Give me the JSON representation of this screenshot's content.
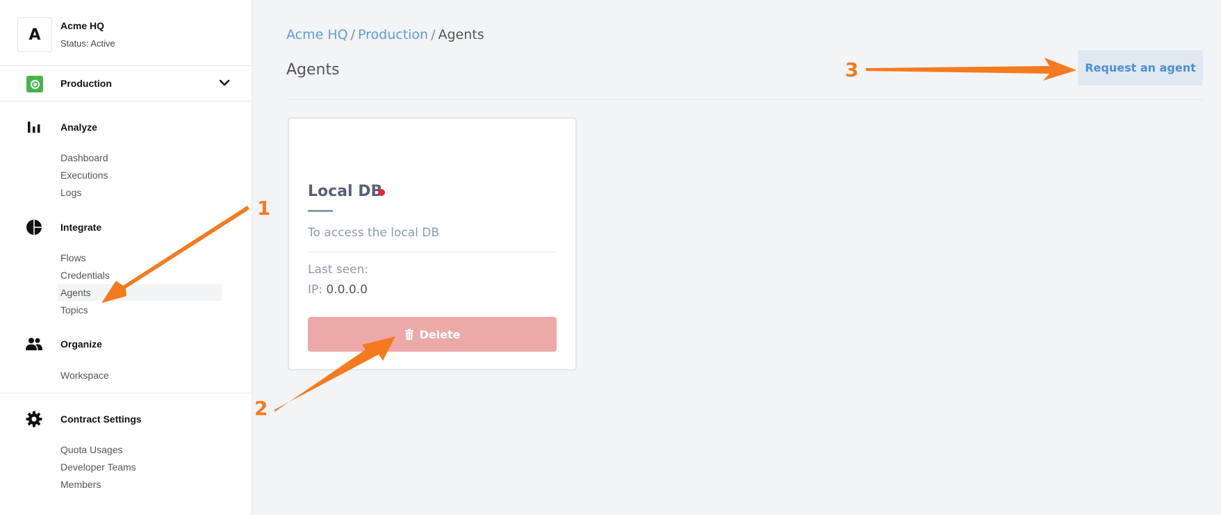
{
  "org": {
    "avatar_letter": "A",
    "name": "Acme HQ",
    "status": "Status: Active"
  },
  "environment": {
    "name": "Production",
    "icon": "environment-icon",
    "icon_color": "#48b54a"
  },
  "sidebar": {
    "analyze": {
      "title": "Analyze",
      "icon": "bar-chart-icon",
      "items": [
        "Dashboard",
        "Executions",
        "Logs"
      ]
    },
    "integrate": {
      "title": "Integrate",
      "icon": "pie-chart-icon",
      "items": [
        "Flows",
        "Credentials",
        "Agents",
        "Topics"
      ],
      "active": "Agents"
    },
    "organize": {
      "title": "Organize",
      "icon": "people-icon",
      "items": [
        "Workspace"
      ]
    },
    "contract": {
      "title": "Contract Settings",
      "icon": "gear-icon",
      "items": [
        "Quota Usages",
        "Developer Teams",
        "Members"
      ]
    }
  },
  "breadcrumb": {
    "items": [
      "Acme HQ",
      "Production",
      "Agents"
    ],
    "separator": "/"
  },
  "page": {
    "title": "Agents",
    "request_button": "Request an agent"
  },
  "agents": [
    {
      "name": "Local DB",
      "status_color": "#e8262e",
      "description": "To access the local DB",
      "last_seen_label": "Last seen:",
      "last_seen_value": "",
      "ip_label": "IP:",
      "ip_value": "0.0.0.0",
      "delete_label": "Delete"
    }
  ],
  "annotations": {
    "labels": [
      "1",
      "2",
      "3"
    ],
    "color": "#f47a1f"
  },
  "colors": {
    "link": "#5b9bdf",
    "delete": "#eca9a8",
    "request_bg": "#e0e8f1",
    "request_text": "#4e8ed6"
  }
}
